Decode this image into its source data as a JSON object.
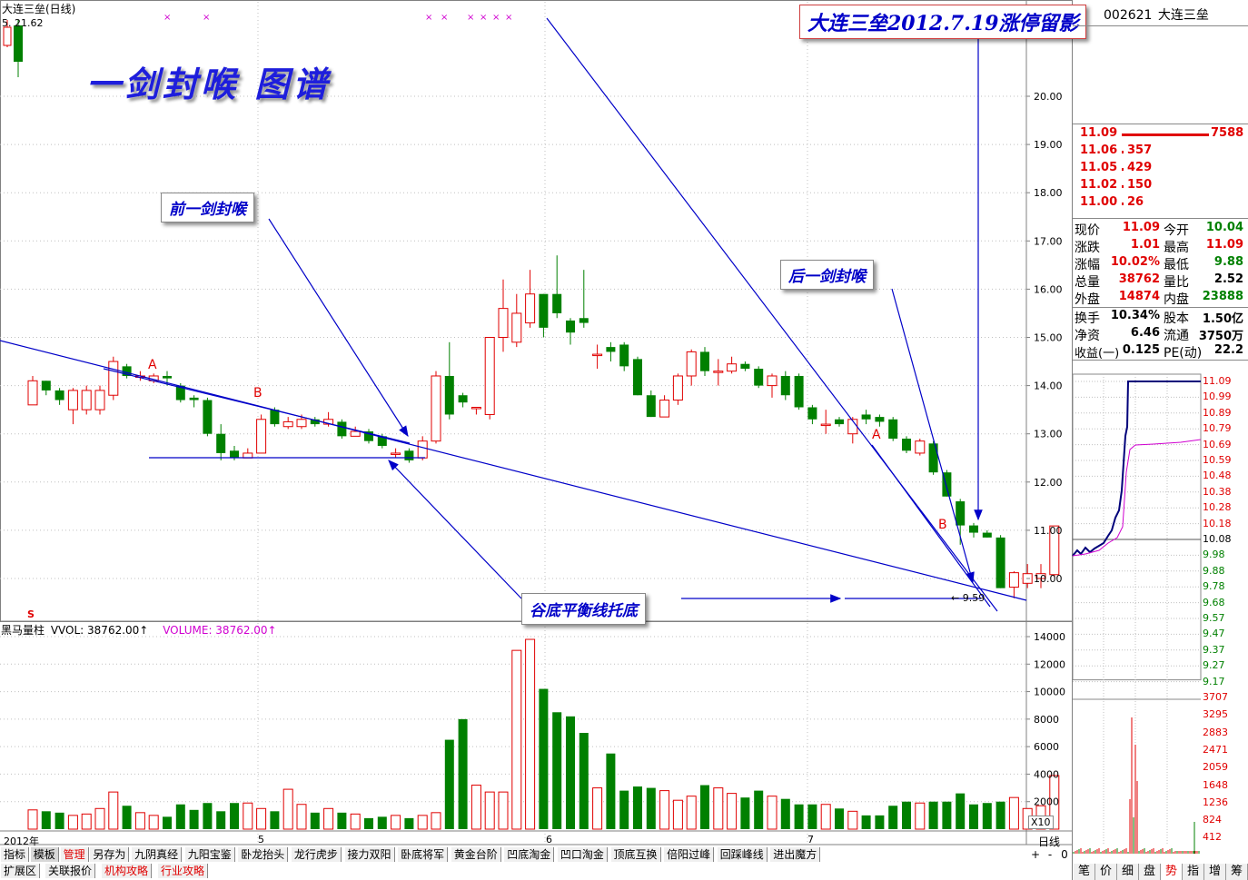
{
  "header": {
    "title": "大连三垒(日线)",
    "ma_line": "5.  21.62",
    "code": "002621",
    "name": "大连三垒"
  },
  "annotations": {
    "big_title": "一剑封喉 图谱",
    "top_callout": "大连三垒2012.7.19涨停留影",
    "callout_front": "前一剑封喉",
    "callout_back": "后一剑封喉",
    "callout_bottom": "谷底平衡线托底",
    "marker_a1": "A",
    "marker_b1": "B",
    "marker_a2": "A",
    "marker_b2": "B",
    "low_label": "← 9.59",
    "s_marker": "S"
  },
  "volume_header": {
    "label1": "黑马量柱",
    "label2": "VVOL: 38762.00↑",
    "label3": "VOLUME: 38762.00↑"
  },
  "axis": {
    "date_labels": [
      "2012年",
      "5",
      "6",
      "7"
    ],
    "x10": "X10",
    "period": "日线"
  },
  "colors": {
    "up": "#e00000",
    "down": "#008000",
    "line": "#0000c8",
    "grid": "#c0c0c0",
    "magenta": "#d000d0"
  },
  "chart_data": [
    {
      "type": "candlestick",
      "title": "大连三垒(日线)",
      "y_ticks": [
        10.0,
        11.0,
        12.0,
        13.0,
        14.0,
        15.0,
        16.0,
        17.0,
        18.0,
        19.0,
        20.0
      ],
      "y_tick_labels": [
        "10.00",
        "11.00",
        "12.00",
        "13.00",
        "14.00",
        "15.00",
        "16.00",
        "17.00",
        "18.00",
        "19.00",
        "20.00"
      ],
      "ylim": [
        9.05,
        21.6
      ],
      "candles": [
        {
          "o": 13.6,
          "c": 14.1,
          "h": 14.2,
          "l": 13.6
        },
        {
          "o": 14.1,
          "c": 13.9,
          "h": 14.1,
          "l": 13.8
        },
        {
          "o": 13.9,
          "c": 13.7,
          "h": 13.95,
          "l": 13.6
        },
        {
          "o": 13.5,
          "c": 13.9,
          "h": 13.95,
          "l": 13.2
        },
        {
          "o": 13.5,
          "c": 13.9,
          "h": 14.0,
          "l": 13.4
        },
        {
          "o": 13.5,
          "c": 13.9,
          "h": 14.0,
          "l": 13.4
        },
        {
          "o": 13.8,
          "c": 14.5,
          "h": 14.6,
          "l": 13.7
        },
        {
          "o": 14.4,
          "c": 14.2,
          "h": 14.45,
          "l": 14.15
        },
        {
          "o": 14.2,
          "c": 14.2,
          "h": 14.3,
          "l": 14.1
        },
        {
          "o": 14.1,
          "c": 14.2,
          "h": 14.25,
          "l": 14.05
        },
        {
          "o": 14.2,
          "c": 14.15,
          "h": 14.3,
          "l": 14.0
        },
        {
          "o": 14.0,
          "c": 13.7,
          "h": 14.05,
          "l": 13.65
        },
        {
          "o": 13.75,
          "c": 13.7,
          "h": 13.8,
          "l": 13.55
        },
        {
          "o": 13.7,
          "c": 13.0,
          "h": 13.75,
          "l": 12.95
        },
        {
          "o": 13.0,
          "c": 12.6,
          "h": 13.2,
          "l": 12.45
        },
        {
          "o": 12.65,
          "c": 12.5,
          "h": 12.75,
          "l": 12.45
        },
        {
          "o": 12.5,
          "c": 12.6,
          "h": 12.7,
          "l": 12.5
        },
        {
          "o": 12.6,
          "c": 13.3,
          "h": 13.4,
          "l": 12.6
        },
        {
          "o": 13.5,
          "c": 13.2,
          "h": 13.55,
          "l": 13.15
        },
        {
          "o": 13.15,
          "c": 13.25,
          "h": 13.35,
          "l": 13.1
        },
        {
          "o": 13.15,
          "c": 13.3,
          "h": 13.4,
          "l": 13.1
        },
        {
          "o": 13.3,
          "c": 13.2,
          "h": 13.35,
          "l": 13.15
        },
        {
          "o": 13.2,
          "c": 13.3,
          "h": 13.45,
          "l": 13.15
        },
        {
          "o": 13.25,
          "c": 12.95,
          "h": 13.3,
          "l": 12.9
        },
        {
          "o": 12.95,
          "c": 13.05,
          "h": 13.15,
          "l": 12.95
        },
        {
          "o": 13.05,
          "c": 12.85,
          "h": 13.1,
          "l": 12.8
        },
        {
          "o": 12.95,
          "c": 12.75,
          "h": 13.0,
          "l": 12.7
        },
        {
          "o": 12.6,
          "c": 12.6,
          "h": 12.7,
          "l": 12.5
        },
        {
          "o": 12.65,
          "c": 12.45,
          "h": 12.7,
          "l": 12.4
        },
        {
          "o": 12.5,
          "c": 12.85,
          "h": 12.95,
          "l": 12.45
        },
        {
          "o": 12.85,
          "c": 14.2,
          "h": 14.3,
          "l": 12.8
        },
        {
          "o": 14.2,
          "c": 13.4,
          "h": 14.9,
          "l": 13.3
        },
        {
          "o": 13.8,
          "c": 13.65,
          "h": 13.85,
          "l": 13.55
        },
        {
          "o": 13.55,
          "c": 13.55,
          "h": 13.55,
          "l": 13.4
        },
        {
          "o": 13.4,
          "c": 15.0,
          "h": 15.0,
          "l": 13.3
        },
        {
          "o": 15.0,
          "c": 15.6,
          "h": 16.2,
          "l": 14.7
        },
        {
          "o": 14.9,
          "c": 15.5,
          "h": 15.9,
          "l": 14.8
        },
        {
          "o": 15.3,
          "c": 15.9,
          "h": 16.4,
          "l": 15.2
        },
        {
          "o": 15.9,
          "c": 15.2,
          "h": 15.9,
          "l": 15.0
        },
        {
          "o": 15.9,
          "c": 15.5,
          "h": 16.7,
          "l": 15.4
        },
        {
          "o": 15.35,
          "c": 15.1,
          "h": 15.4,
          "l": 14.85
        },
        {
          "o": 15.4,
          "c": 15.3,
          "h": 16.4,
          "l": 15.2
        },
        {
          "o": 14.65,
          "c": 14.65,
          "h": 14.85,
          "l": 14.35
        },
        {
          "o": 14.8,
          "c": 14.7,
          "h": 14.9,
          "l": 14.5
        },
        {
          "o": 14.85,
          "c": 14.4,
          "h": 14.9,
          "l": 14.3
        },
        {
          "o": 14.55,
          "c": 13.8,
          "h": 14.6,
          "l": 13.8
        },
        {
          "o": 13.8,
          "c": 13.35,
          "h": 13.9,
          "l": 13.35
        },
        {
          "o": 13.35,
          "c": 13.7,
          "h": 13.8,
          "l": 13.35
        },
        {
          "o": 13.7,
          "c": 14.2,
          "h": 14.25,
          "l": 13.6
        },
        {
          "o": 14.2,
          "c": 14.7,
          "h": 14.75,
          "l": 14.0
        },
        {
          "o": 14.7,
          "c": 14.3,
          "h": 14.8,
          "l": 14.2
        },
        {
          "o": 14.3,
          "c": 14.3,
          "h": 14.55,
          "l": 14.0
        },
        {
          "o": 14.3,
          "c": 14.45,
          "h": 14.6,
          "l": 14.25
        },
        {
          "o": 14.45,
          "c": 14.35,
          "h": 14.5,
          "l": 14.3
        },
        {
          "o": 14.35,
          "c": 14.0,
          "h": 14.4,
          "l": 13.95
        },
        {
          "o": 14.0,
          "c": 14.2,
          "h": 14.25,
          "l": 13.75
        },
        {
          "o": 14.2,
          "c": 13.8,
          "h": 14.3,
          "l": 13.7
        },
        {
          "o": 14.2,
          "c": 13.55,
          "h": 14.25,
          "l": 13.5
        },
        {
          "o": 13.55,
          "c": 13.3,
          "h": 13.6,
          "l": 13.2
        },
        {
          "o": 13.2,
          "c": 13.2,
          "h": 13.5,
          "l": 13.0
        },
        {
          "o": 13.3,
          "c": 13.2,
          "h": 13.35,
          "l": 13.15
        },
        {
          "o": 13.0,
          "c": 13.3,
          "h": 13.35,
          "l": 12.8
        },
        {
          "o": 13.4,
          "c": 13.3,
          "h": 13.5,
          "l": 13.2
        },
        {
          "o": 13.35,
          "c": 13.25,
          "h": 13.4,
          "l": 13.15
        },
        {
          "o": 13.3,
          "c": 12.9,
          "h": 13.35,
          "l": 12.85
        },
        {
          "o": 12.9,
          "c": 12.65,
          "h": 12.95,
          "l": 12.6
        },
        {
          "o": 12.6,
          "c": 12.85,
          "h": 12.9,
          "l": 12.55
        },
        {
          "o": 12.8,
          "c": 12.2,
          "h": 12.85,
          "l": 12.15
        },
        {
          "o": 12.2,
          "c": 11.7,
          "h": 12.25,
          "l": 11.7
        },
        {
          "o": 11.6,
          "c": 11.1,
          "h": 11.65,
          "l": 10.7
        },
        {
          "o": 11.1,
          "c": 10.95,
          "h": 11.15,
          "l": 10.85
        },
        {
          "o": 10.95,
          "c": 10.85,
          "h": 11.0,
          "l": 10.85
        },
        {
          "o": 10.85,
          "c": 9.8,
          "h": 10.9,
          "l": 9.8
        },
        {
          "o": 9.82,
          "c": 10.12,
          "h": 10.15,
          "l": 9.59
        },
        {
          "o": 9.9,
          "c": 10.1,
          "h": 10.3,
          "l": 9.8
        },
        {
          "o": 10.0,
          "c": 10.1,
          "h": 10.3,
          "l": 9.8
        },
        {
          "o": 10.08,
          "c": 11.09,
          "h": 11.09,
          "l": 10.04
        }
      ]
    },
    {
      "type": "bar",
      "title": "黑马量柱",
      "y_ticks": [
        2000,
        4000,
        6000,
        8000,
        10000,
        12000,
        14000
      ],
      "y_tick_labels": [
        "2000",
        "4000",
        "6000",
        "8000",
        "10000",
        "12000",
        "14000"
      ],
      "ylim": [
        0,
        15000
      ],
      "series": [
        {
          "values": [
            1400,
            1300,
            1200,
            1000,
            1100,
            1500,
            2700,
            1700,
            1200,
            1000,
            900,
            1800,
            1400,
            1900,
            1300,
            1900,
            1900,
            1500,
            1300,
            2900,
            1800,
            1200,
            1500,
            1200,
            1100,
            800,
            900,
            1000,
            800,
            1000,
            1200,
            6500,
            8000,
            3200,
            2700,
            2700,
            13000,
            13800,
            10200,
            8500,
            8200,
            7000,
            3000,
            5500,
            2800,
            3100,
            3000,
            2800,
            2100,
            2400,
            3200,
            3000,
            2600,
            2300,
            2800,
            2400,
            2200,
            1800,
            1800,
            1800,
            1500,
            1300,
            1000,
            1000,
            1700,
            2000,
            1900,
            2000,
            2000,
            2600,
            1800,
            1900,
            2000,
            2300,
            1500,
            1700,
            3900
          ]
        }
      ]
    }
  ],
  "quote": {
    "bids": [
      {
        "price": "11.09",
        "vol": "7588"
      },
      {
        "price": "11.06",
        "vol": "357"
      },
      {
        "price": "11.05",
        "vol": "429"
      },
      {
        "price": "11.02",
        "vol": "150"
      },
      {
        "price": "11.00",
        "vol": "26"
      }
    ],
    "rows": [
      {
        "k1": "现价",
        "v1": "11.09",
        "k2": "今开",
        "v2": "10.04"
      },
      {
        "k1": "涨跌",
        "v1": "1.01",
        "k2": "最高",
        "v2": "11.09"
      },
      {
        "k1": "涨幅",
        "v1": "10.02%",
        "k2": "最低",
        "v2": "9.88"
      },
      {
        "k1": "总量",
        "v1": "38762",
        "k2": "量比",
        "v2": "2.52"
      },
      {
        "k1": "外盘",
        "v1": "14874",
        "k2": "内盘",
        "v2": "23888"
      },
      {
        "k1": "换手",
        "v1": "10.34%",
        "k2": "股本",
        "v2": "1.50亿"
      },
      {
        "k1": "净资",
        "v1": "6.46",
        "k2": "流通",
        "v2": "3750万"
      },
      {
        "k1": "收益(一)",
        "v1": "0.125",
        "k2": "PE(动)",
        "v2": "22.2"
      }
    ],
    "intraday_labels_top": [
      "11.09",
      "10.99",
      "10.89",
      "10.79",
      "10.69",
      "10.59",
      "10.48",
      "10.38",
      "10.28",
      "10.18",
      "10.08",
      "9.98",
      "9.88",
      "9.78",
      "9.68",
      "9.57",
      "9.47",
      "9.37",
      "9.27",
      "9.17"
    ],
    "intraday_vol_labels": [
      "3707",
      "3295",
      "2883",
      "2471",
      "2059",
      "1648",
      "1236",
      "824",
      "412"
    ]
  },
  "tabs": {
    "row1": [
      "指标",
      "模板",
      "管理",
      "另存为",
      "九阴真经",
      "九阳宝鉴",
      "卧龙抬头",
      "龙行虎步",
      "接力双阳",
      "卧底将军",
      "黄金台阶",
      "凹底淘金",
      "凹口淘金",
      "顶底互换",
      "倍阳过峰",
      "回踩峰线",
      "进出魔方"
    ],
    "row2": [
      "扩展区",
      "关联报价",
      "机构攻略",
      "行业攻略"
    ],
    "right_tabs": [
      "笔",
      "价",
      "细",
      "盘",
      "势",
      "指",
      "增",
      "筹"
    ],
    "right_controls": [
      "+",
      "-",
      "0"
    ]
  }
}
